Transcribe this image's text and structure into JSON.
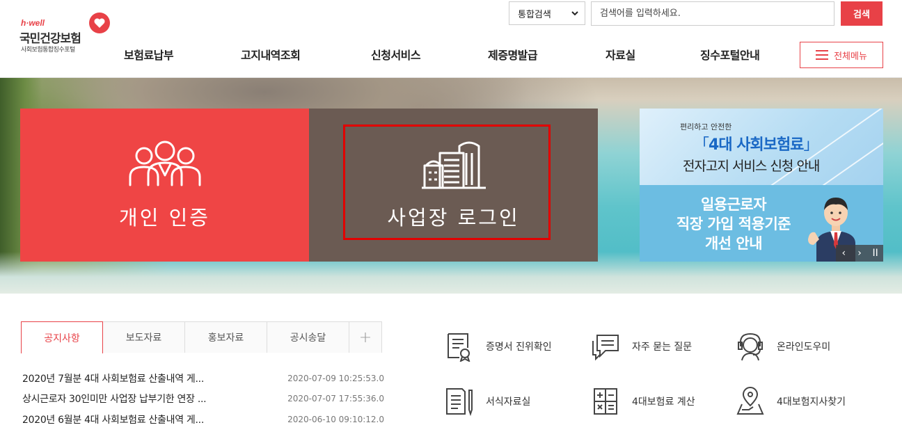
{
  "logo": {
    "tagline": "h·well",
    "name": "국민건강보험",
    "sub": "사회보험통합징수포털"
  },
  "search": {
    "scope": "통합검색",
    "placeholder": "검색어를 입력하세요.",
    "button": "검색"
  },
  "nav": {
    "items": [
      "보험료납부",
      "고지내역조회",
      "신청서비스",
      "제증명발급",
      "자료실",
      "징수포털안내"
    ],
    "all_menu": "전체메뉴"
  },
  "hero": {
    "personal_label": "개인 인증",
    "business_label": "사업장 로그인",
    "banner_top": {
      "small": "편리하고 안전한",
      "title_open": "「",
      "title": "4대 사회보험료",
      "title_close": "」",
      "subtitle": "전자고지 서비스 신청 안내"
    },
    "banner_bottom": {
      "line1": "일용근로자",
      "line2": "직장 가입 적용기준",
      "line3": "개선 안내"
    },
    "slider": {
      "prev": "‹",
      "next": "›",
      "pause": "II"
    }
  },
  "notices": {
    "tabs": [
      "공지사항",
      "보도자료",
      "홍보자료",
      "공시송달",
      "+"
    ],
    "items": [
      {
        "title": "2020년 7월분 4대 사회보험료 산출내역 게...",
        "date": "2020-07-09 10:25:53.0"
      },
      {
        "title": "상시근로자 30인미만 사업장 납부기한 연장 ...",
        "date": "2020-07-07 17:55:36.0"
      },
      {
        "title": "2020년 6월분 4대 사회보험료 산출내역 게...",
        "date": "2020-06-10 09:10:12.0"
      }
    ]
  },
  "quick_links": [
    "증명서 진위확인",
    "자주 묻는 질문",
    "온라인도우미",
    "서식자료실",
    "4대보험료 계산",
    "4대보험지사찾기"
  ],
  "colors": {
    "accent": "#e84147",
    "personal_card": "#ef4545",
    "business_card": "#6b5b53",
    "focus_frame": "#e10000"
  }
}
